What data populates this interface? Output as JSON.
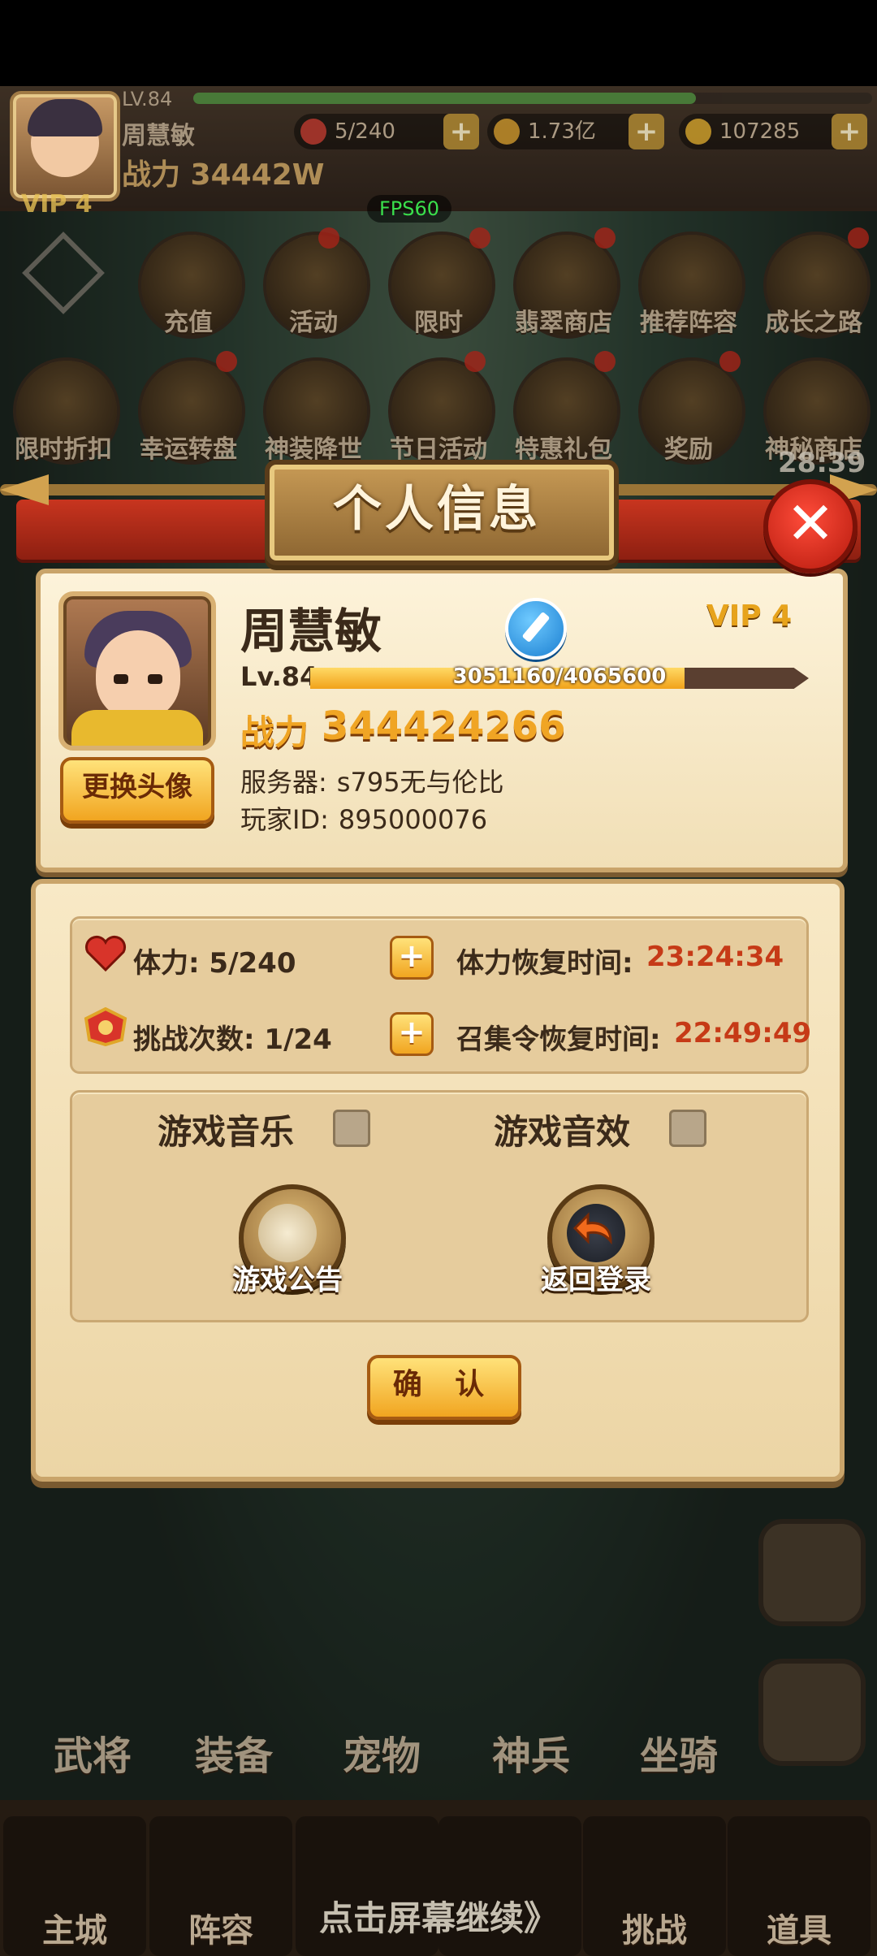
{
  "header": {
    "level": "LV.84",
    "player_name": "周慧敏",
    "power": "战力 34442W",
    "vip": "VIP 4",
    "stamina": "5/240",
    "gold": "1.73亿",
    "gems": "107285",
    "fps": "FPS60"
  },
  "menu_row1": [
    "充值",
    "活动",
    "限时",
    "翡翠商店",
    "推荐阵容",
    "成长之路"
  ],
  "menu_row2": [
    "限时折扣",
    "幸运转盘",
    "神装降世",
    "节日活动",
    "特惠礼包",
    "奖励",
    "神秘商店"
  ],
  "countdown": "28:39",
  "dialog": {
    "title": "个人信息",
    "name": "周慧敏",
    "vip": "VIP 4",
    "level": "Lv.84",
    "exp_text": "3051160/4065600",
    "exp_fraction": 0.75,
    "power_label": "战力",
    "power_value": "344424266",
    "change_avatar": "更换头像",
    "server_label": "服务器:",
    "server_value": "s795无与伦比",
    "id_label": "玩家ID:",
    "id_value": "895000076",
    "stamina_label": "体力: 5/240",
    "stamina_recover_label": "体力恢复时间:",
    "stamina_recover_time": "23:24:34",
    "challenge_label": "挑战次数: 1/24",
    "summon_recover_label": "召集令恢复时间:",
    "summon_recover_time": "22:49:49",
    "music_label": "游戏音乐",
    "sfx_label": "游戏音效",
    "announcement": "游戏公告",
    "back_login": "返回登录",
    "confirm": "确 认"
  },
  "side_nav": [
    "武将",
    "装备",
    "宠物",
    "神兵",
    "坐骑"
  ],
  "bottom_tabs": [
    "主城",
    "阵容",
    "挑战",
    "道具"
  ],
  "hint": "点击屏幕继续》",
  "colors": {
    "accent_gold": "#f0a524",
    "timer_red": "#c63a17",
    "close_red": "#d42a1a"
  }
}
